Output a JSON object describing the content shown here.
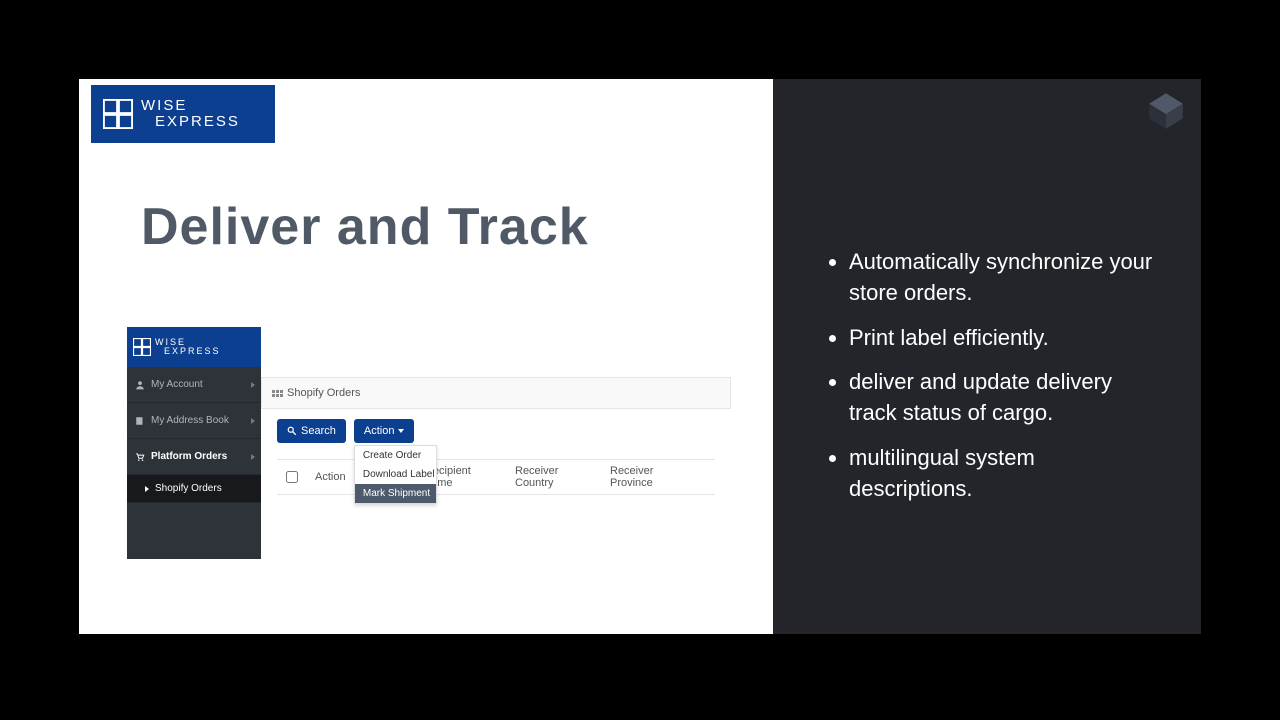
{
  "brand": {
    "line1": "WISE",
    "line2": "EXPRESS"
  },
  "slide_title": "Deliver and Track",
  "app": {
    "nav": {
      "account": "My Account",
      "address": "My Address Book",
      "platform": "Platform Orders",
      "sub_shopify": "Shopify Orders"
    },
    "panel_title": "Shopify Orders",
    "toolbar": {
      "search": "Search",
      "action": "Action"
    },
    "dropdown": {
      "create": "Create Order",
      "download": "Download Label",
      "ship": "Mark Shipment"
    },
    "table": {
      "action": "Action",
      "recipient": "Recipient name",
      "country": "Receiver Country",
      "province": "Receiver Province"
    }
  },
  "bullets": {
    "b1": "Automatically synchronize  your store orders.",
    "b2": "Print label efficiently.",
    "b3": "deliver and update delivery track status of cargo.",
    "b4": "multilingual system descriptions."
  }
}
